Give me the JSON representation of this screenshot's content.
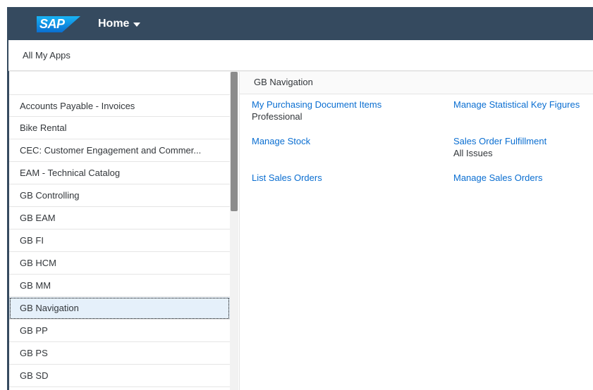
{
  "topbar": {
    "logo_text": "SAP",
    "home_label": "Home",
    "bg_color": "#354a5f"
  },
  "header": {
    "title": "All My Apps"
  },
  "sidebar": {
    "items": [
      {
        "label": "Accounts Payable - Invoices",
        "selected": false
      },
      {
        "label": "Bike Rental",
        "selected": false
      },
      {
        "label": "CEC: Customer Engagement and Commer...",
        "selected": false
      },
      {
        "label": "EAM - Technical Catalog",
        "selected": false
      },
      {
        "label": "GB Controlling",
        "selected": false
      },
      {
        "label": "GB EAM",
        "selected": false
      },
      {
        "label": "GB FI",
        "selected": false
      },
      {
        "label": "GB HCM",
        "selected": false
      },
      {
        "label": "GB MM",
        "selected": false
      },
      {
        "label": "GB Navigation",
        "selected": true
      },
      {
        "label": "GB PP",
        "selected": false
      },
      {
        "label": "GB PS",
        "selected": false
      },
      {
        "label": "GB SD",
        "selected": false
      }
    ]
  },
  "content": {
    "title": "GB Navigation",
    "apps": [
      {
        "title": "My Purchasing Document Items",
        "subtitle": "Professional"
      },
      {
        "title": "Manage Statistical Key Figures",
        "subtitle": ""
      },
      {
        "title": "Manage Stock",
        "subtitle": ""
      },
      {
        "title": "Sales Order Fulfillment",
        "subtitle": "All Issues"
      },
      {
        "title": "List Sales Orders",
        "subtitle": ""
      },
      {
        "title": "Manage Sales Orders",
        "subtitle": ""
      }
    ],
    "link_color": "#0a6ed1"
  }
}
